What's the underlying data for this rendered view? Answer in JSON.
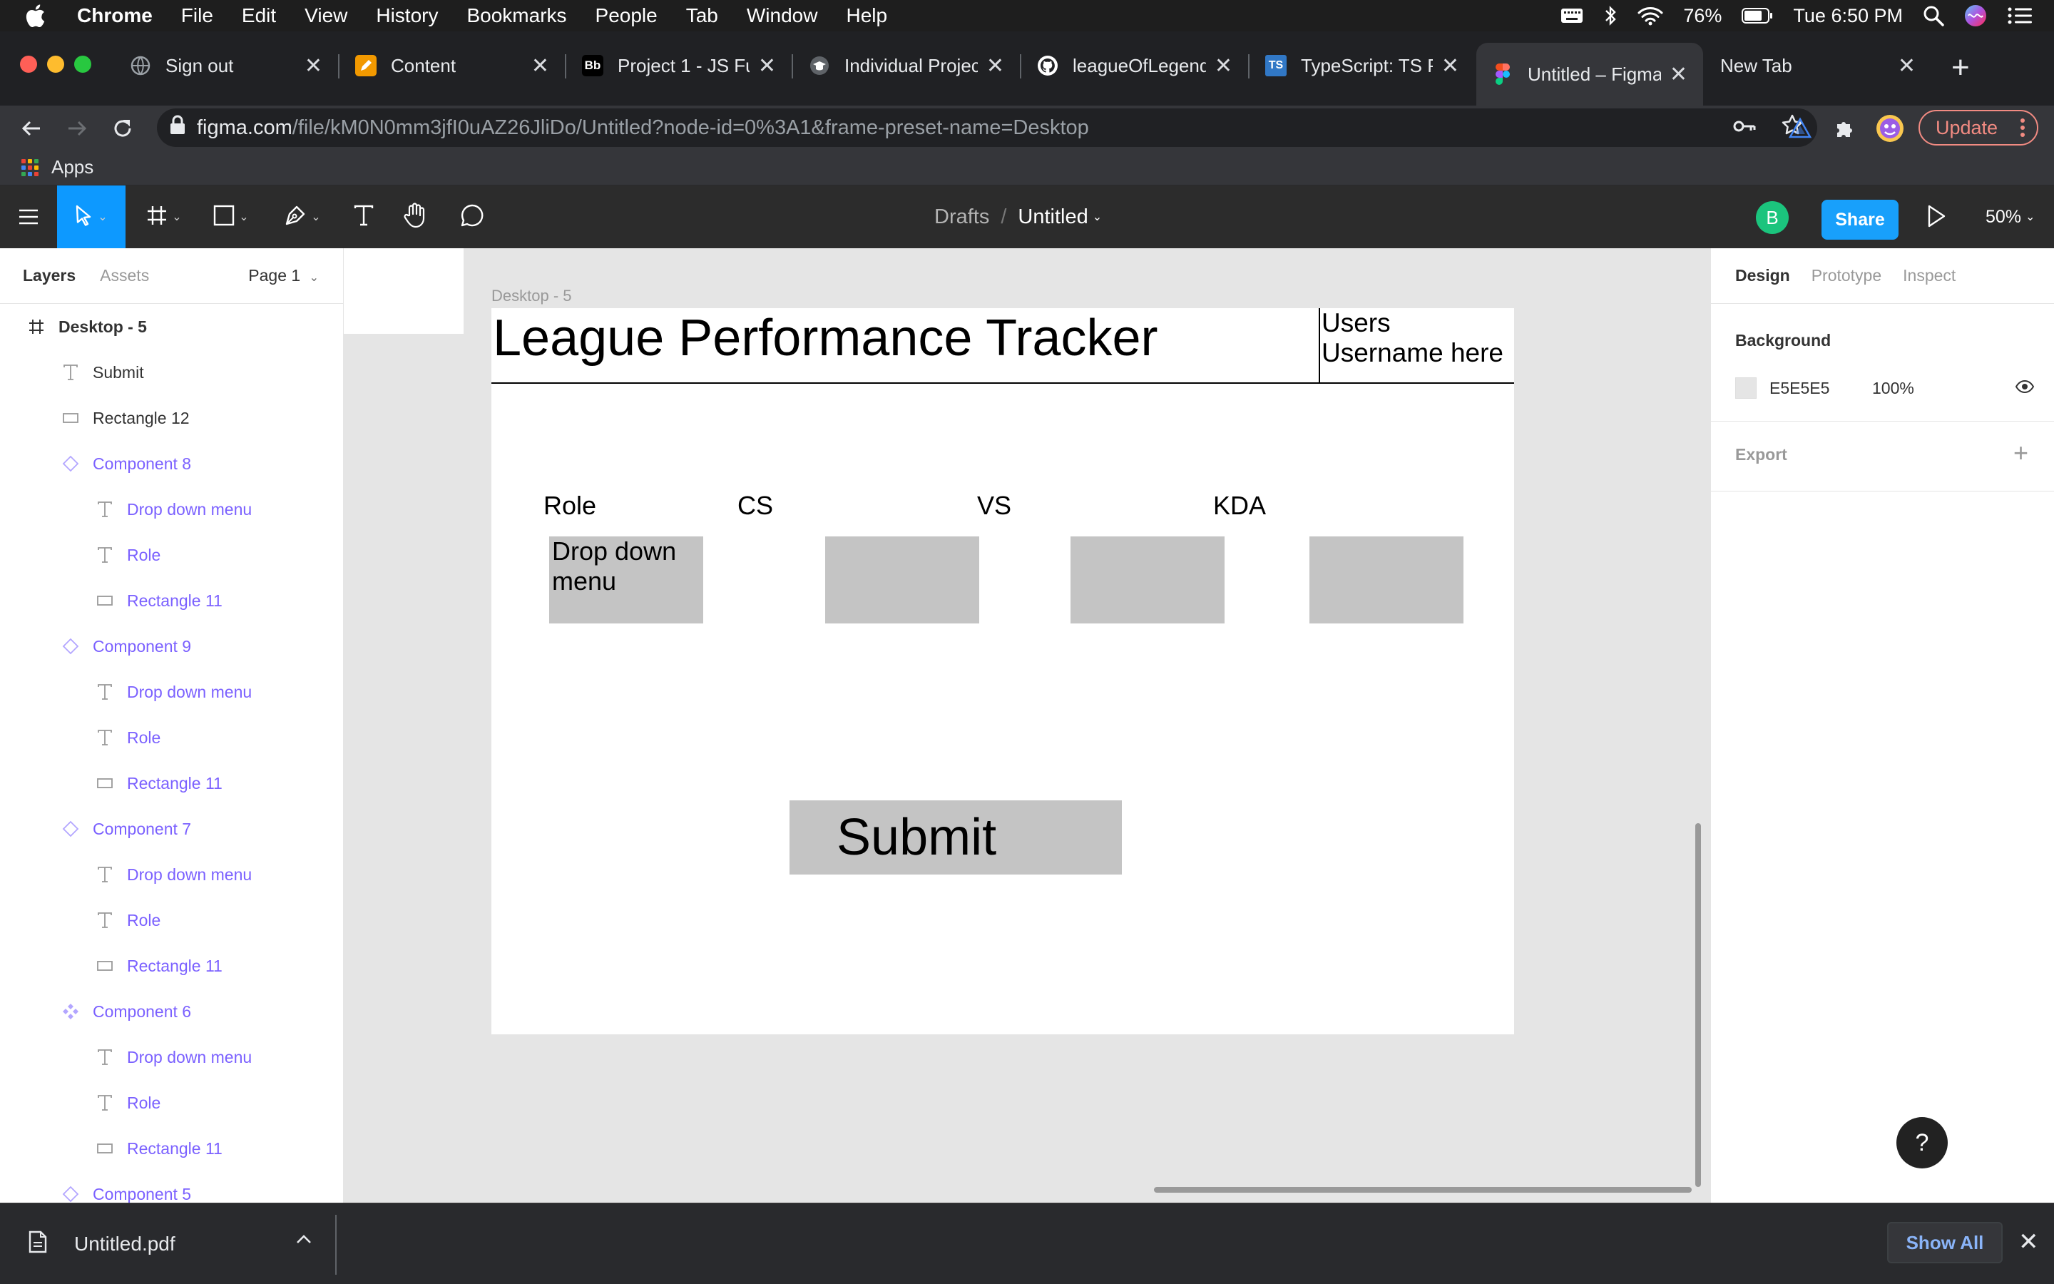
{
  "menubar": {
    "app": "Chrome",
    "items": [
      "File",
      "Edit",
      "View",
      "History",
      "Bookmarks",
      "People",
      "Tab",
      "Window",
      "Help"
    ],
    "battery": "76%",
    "clock": "Tue 6:50 PM"
  },
  "tabs": [
    {
      "title": "Sign out",
      "icon": "globe-icon"
    },
    {
      "title": "Content",
      "icon": "pencil-icon"
    },
    {
      "title": "Project 1 - JS Fu",
      "icon": "bb-icon"
    },
    {
      "title": "Individual Projec",
      "icon": "cap-icon"
    },
    {
      "title": "leagueOfLegend",
      "icon": "github-icon"
    },
    {
      "title": "TypeScript: TS P",
      "icon": "ts-icon"
    },
    {
      "title": "Untitled – Figma",
      "icon": "figma-icon",
      "active": true
    },
    {
      "title": "New Tab",
      "icon": "none"
    }
  ],
  "address": {
    "host": "figma.com",
    "path": "/file/kM0N0mm3jfI0uAZ26JliDo/Untitled?node-id=0%3A1&frame-preset-name=Desktop",
    "update_label": "Update"
  },
  "bookmarks": {
    "apps_label": "Apps"
  },
  "figma": {
    "breadcrumb_drafts": "Drafts",
    "breadcrumb_sep": "/",
    "file_name": "Untitled",
    "avatar_initial": "B",
    "share_label": "Share",
    "zoom": "50%"
  },
  "left_panel": {
    "tab_layers": "Layers",
    "tab_assets": "Assets",
    "page": "Page 1",
    "layers": [
      {
        "label": "Desktop - 5",
        "type": "frame",
        "indent": 0
      },
      {
        "label": "Submit",
        "type": "text",
        "indent": 1
      },
      {
        "label": "Rectangle 12",
        "type": "rect",
        "indent": 1
      },
      {
        "label": "Component 8",
        "type": "instance",
        "indent": 1
      },
      {
        "label": "Drop down menu",
        "type": "text",
        "indent": 2
      },
      {
        "label": "Role",
        "type": "text",
        "indent": 2
      },
      {
        "label": "Rectangle 11",
        "type": "rect",
        "indent": 2
      },
      {
        "label": "Component 9",
        "type": "instance",
        "indent": 1
      },
      {
        "label": "Drop down menu",
        "type": "text",
        "indent": 2
      },
      {
        "label": "Role",
        "type": "text",
        "indent": 2
      },
      {
        "label": "Rectangle 11",
        "type": "rect",
        "indent": 2
      },
      {
        "label": "Component 7",
        "type": "instance",
        "indent": 1
      },
      {
        "label": "Drop down menu",
        "type": "text",
        "indent": 2
      },
      {
        "label": "Role",
        "type": "text",
        "indent": 2
      },
      {
        "label": "Rectangle 11",
        "type": "rect",
        "indent": 2
      },
      {
        "label": "Component 6",
        "type": "component",
        "indent": 1
      },
      {
        "label": "Drop down menu",
        "type": "text",
        "indent": 2
      },
      {
        "label": "Role",
        "type": "text",
        "indent": 2
      },
      {
        "label": "Rectangle 11",
        "type": "rect",
        "indent": 2
      },
      {
        "label": "Component 5",
        "type": "instance",
        "indent": 1
      }
    ]
  },
  "canvas": {
    "frame_label": "Desktop - 5",
    "title": "League Performance Tracker",
    "username": "Users Username here",
    "stats": [
      {
        "label": "Role",
        "box_text": "Drop down menu"
      },
      {
        "label": "CS",
        "box_text": ""
      },
      {
        "label": "VS",
        "box_text": ""
      },
      {
        "label": "KDA",
        "box_text": ""
      }
    ],
    "submit": "Submit"
  },
  "right_panel": {
    "tab_design": "Design",
    "tab_prototype": "Prototype",
    "tab_inspect": "Inspect",
    "background_title": "Background",
    "bg_hex": "E5E5E5",
    "bg_opacity": "100%",
    "export_title": "Export",
    "help": "?"
  },
  "downloads": {
    "file": "Untitled.pdf",
    "show_all": "Show All"
  },
  "colors": {
    "figma_blue": "#18a0fb",
    "component_purple": "#7b61ff",
    "canvas_bg": "#E5E5E5",
    "placeholder_gray": "#C4C4C4"
  }
}
